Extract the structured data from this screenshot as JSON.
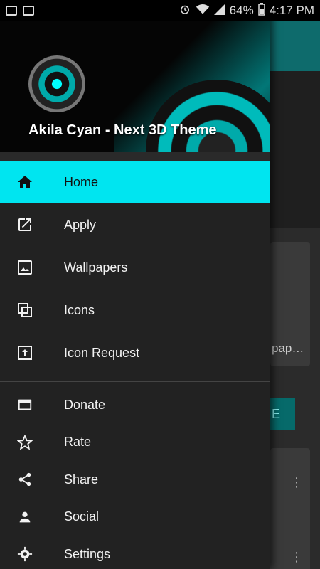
{
  "status_bar": {
    "battery": "64%",
    "time": "4:17 PM"
  },
  "drawer": {
    "header": {
      "title": "Akila Cyan - Next 3D Theme"
    },
    "primary_items": [
      {
        "label": "Home",
        "icon": "home-icon",
        "active": true
      },
      {
        "label": "Apply",
        "icon": "open-in-new-icon",
        "active": false
      },
      {
        "label": "Wallpapers",
        "icon": "image-icon",
        "active": false
      },
      {
        "label": "Icons",
        "icon": "copy-icon",
        "active": false
      },
      {
        "label": "Icon Request",
        "icon": "upload-icon",
        "active": false
      }
    ],
    "secondary_items": [
      {
        "label": "Donate",
        "icon": "card-icon"
      },
      {
        "label": "Rate",
        "icon": "star-icon"
      },
      {
        "label": "Share",
        "icon": "share-icon"
      },
      {
        "label": "Social",
        "icon": "person-icon"
      },
      {
        "label": "Settings",
        "icon": "gear-icon"
      }
    ]
  },
  "background": {
    "card_text": "pap…",
    "button_text": "E"
  },
  "colors": {
    "accent": "#00e5f0",
    "drawer_bg": "#222222"
  }
}
